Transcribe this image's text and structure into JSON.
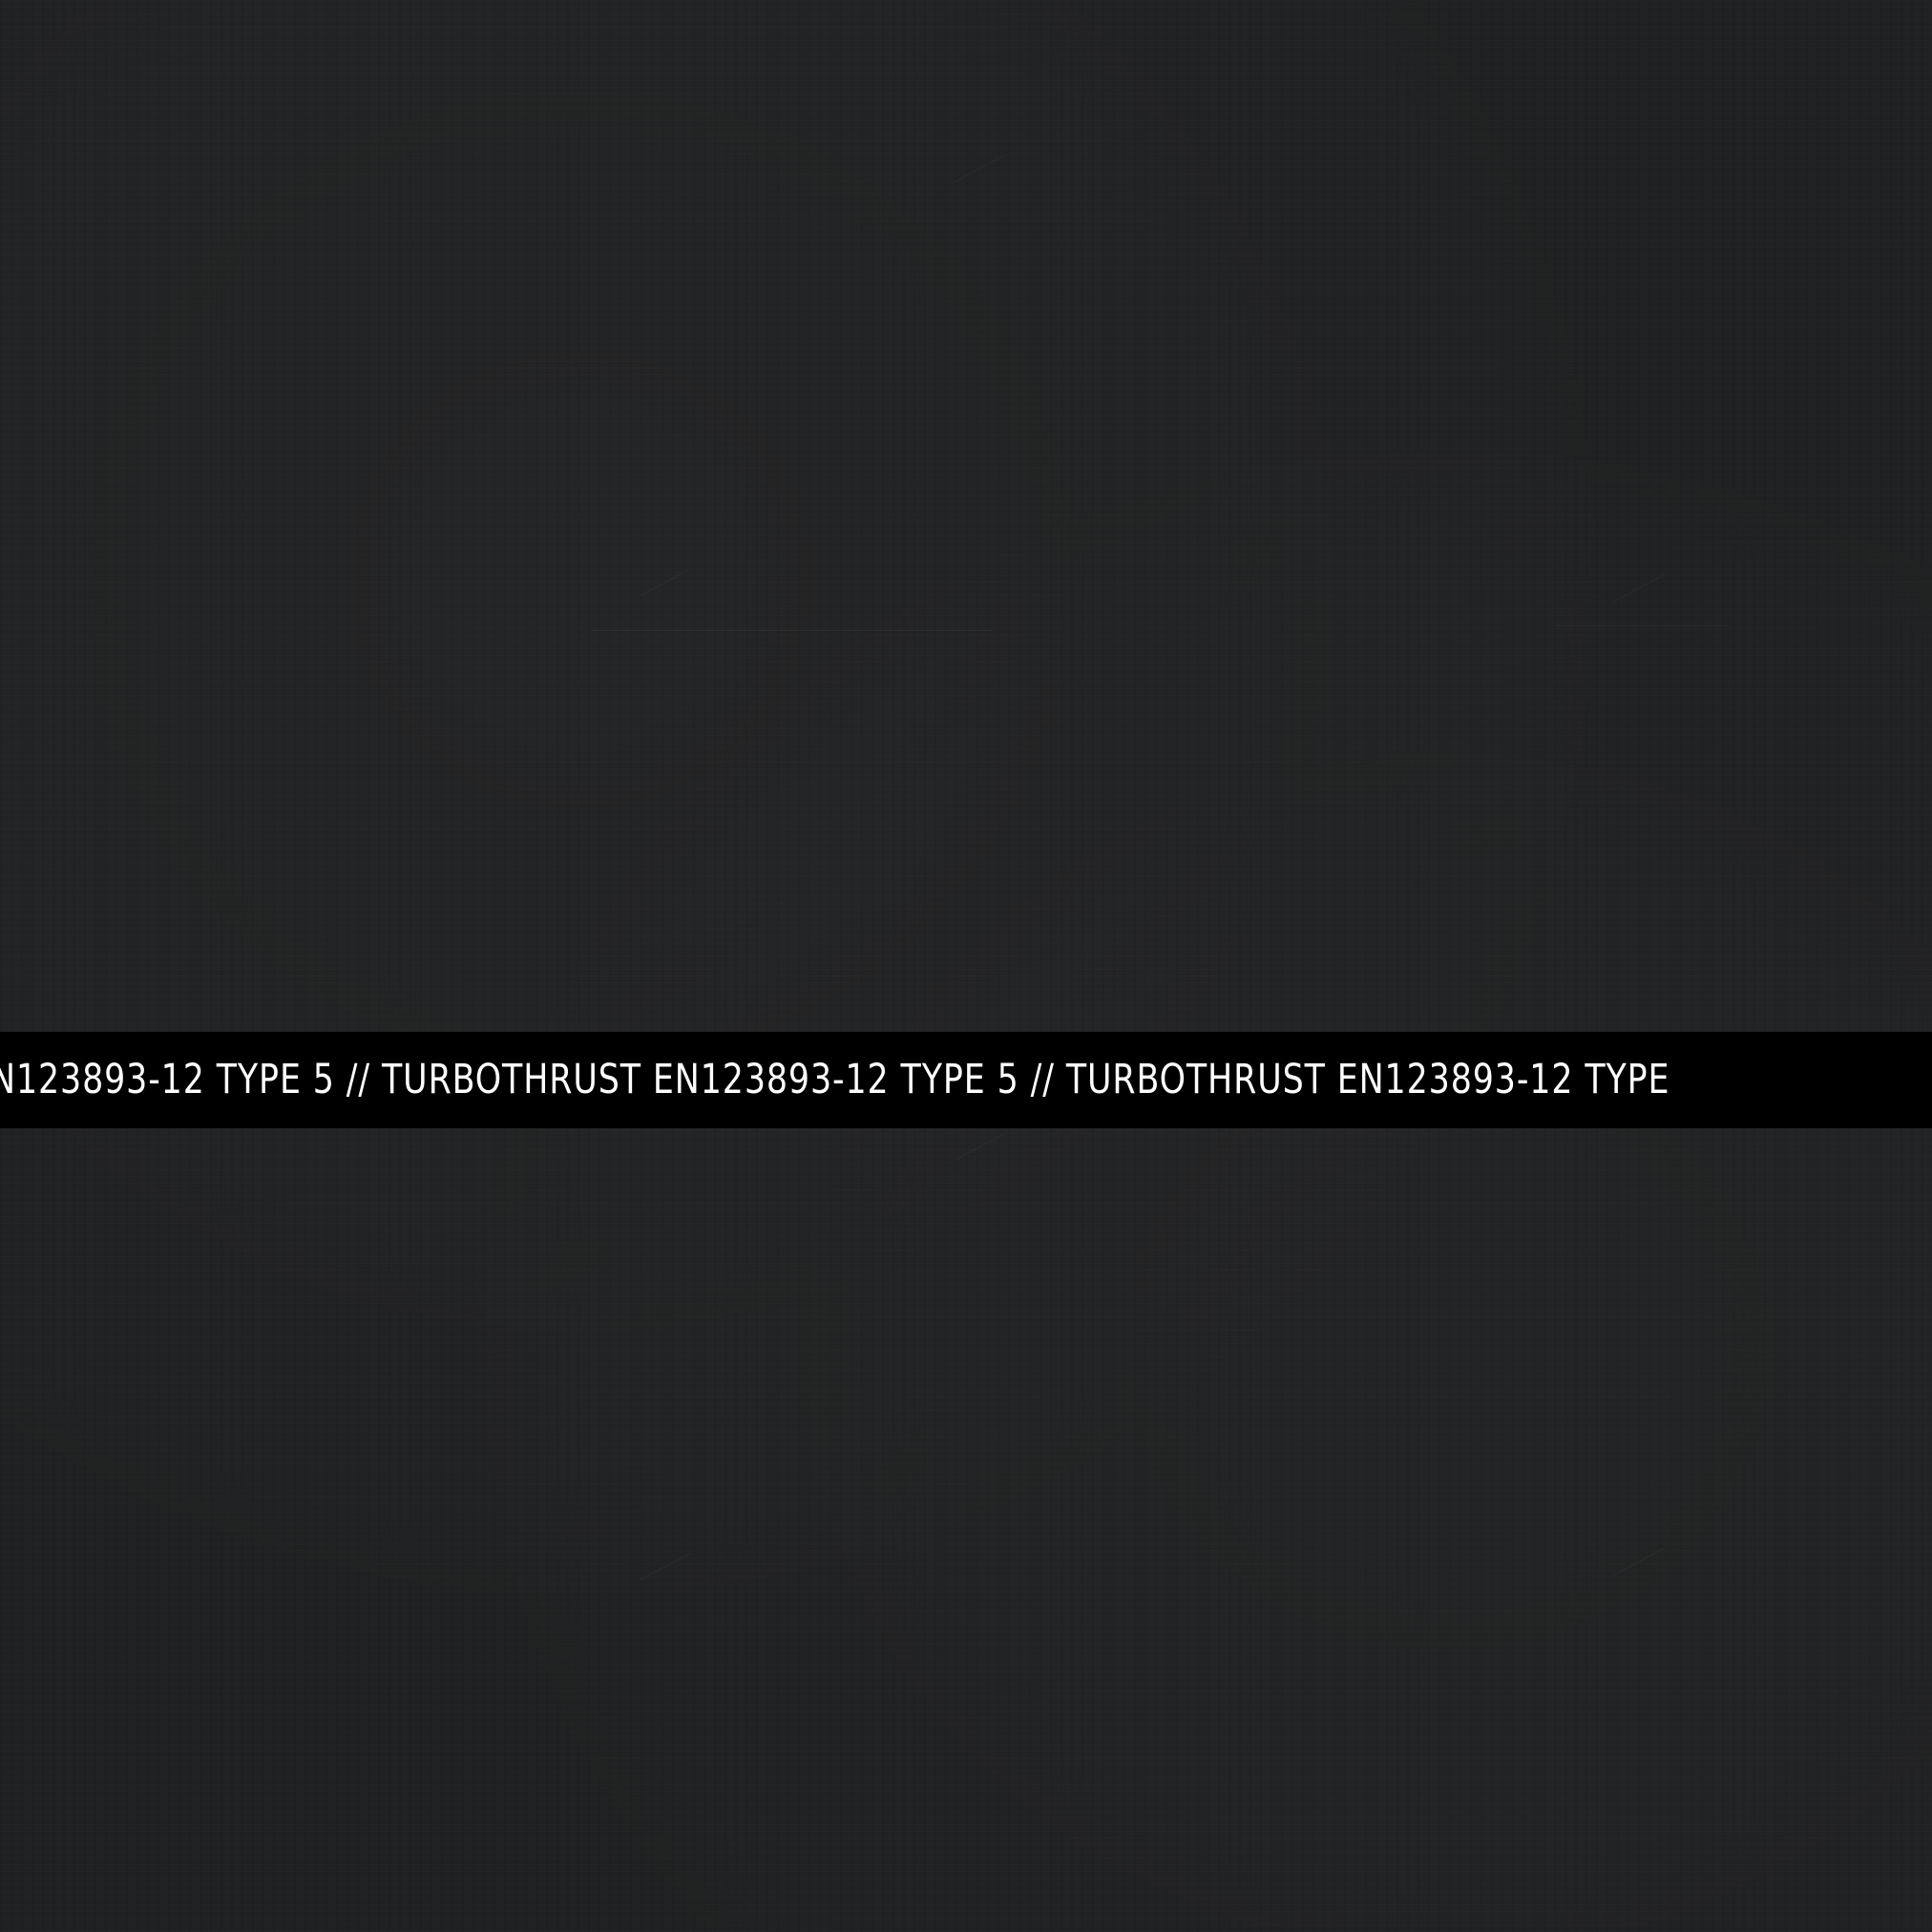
{
  "background": {
    "color": "#202122"
  },
  "band": {
    "color": "#000000",
    "text_color": "#ffffff",
    "text": "N123893-12 TYPE 5 // TURBOTHRUST EN123893-12 TYPE 5 // TURBOTHRUST EN123893-12 TYPE"
  }
}
